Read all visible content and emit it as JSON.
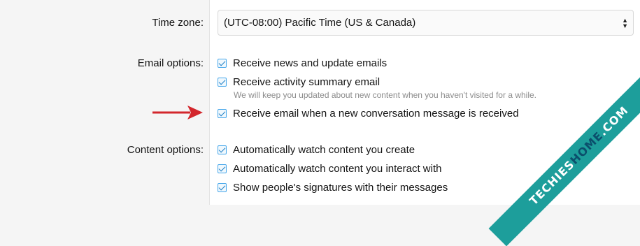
{
  "timezone": {
    "label": "Time zone:",
    "selected": "(UTC-08:00) Pacific Time (US & Canada)"
  },
  "email_options": {
    "label": "Email options:",
    "items": [
      {
        "label": "Receive news and update emails",
        "checked": true
      },
      {
        "label": "Receive activity summary email",
        "checked": true,
        "hint": "We will keep you updated about new content when you haven't visited for a while."
      },
      {
        "label": "Receive email when a new conversation message is received",
        "checked": true
      }
    ]
  },
  "content_options": {
    "label": "Content options:",
    "items": [
      {
        "label": "Automatically watch content you create",
        "checked": true
      },
      {
        "label": "Automatically watch content you interact with",
        "checked": true
      },
      {
        "label": "Show people's signatures with their messages",
        "checked": true
      }
    ]
  },
  "watermark": {
    "text_part1": "TECHIES",
    "text_part2": "HOME",
    "text_part3": ".COM"
  },
  "colors": {
    "accent": "#47a7eb",
    "arrow": "#d3262c",
    "ribbon": "#1d9e9b"
  }
}
